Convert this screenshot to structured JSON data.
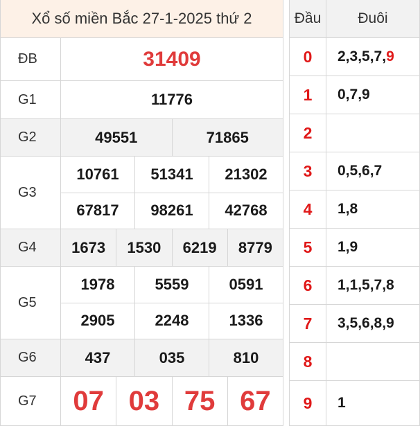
{
  "title": "Xổ số miền Bắc 27-1-2025 thứ 2",
  "prizes": {
    "db": {
      "label": "ĐB",
      "values": [
        "31409"
      ]
    },
    "g1": {
      "label": "G1",
      "values": [
        "11776"
      ]
    },
    "g2": {
      "label": "G2",
      "values": [
        "49551",
        "71865"
      ]
    },
    "g3": {
      "label": "G3",
      "values": [
        "10761",
        "51341",
        "21302",
        "67817",
        "98261",
        "42768"
      ]
    },
    "g4": {
      "label": "G4",
      "values": [
        "1673",
        "1530",
        "6219",
        "8779"
      ]
    },
    "g5": {
      "label": "G5",
      "values": [
        "1978",
        "5559",
        "0591",
        "2905",
        "2248",
        "1336"
      ]
    },
    "g6": {
      "label": "G6",
      "values": [
        "437",
        "035",
        "810"
      ]
    },
    "g7": {
      "label": "G7",
      "values": [
        "07",
        "03",
        "75",
        "67"
      ]
    }
  },
  "loto": {
    "head_label": "Đầu",
    "tail_label": "Đuôi",
    "rows": [
      {
        "head": "0",
        "tails": "2,3,5,7,",
        "tail_highlight": "9"
      },
      {
        "head": "1",
        "tails": "0,7,9",
        "tail_highlight": ""
      },
      {
        "head": "2",
        "tails": "",
        "tail_highlight": ""
      },
      {
        "head": "3",
        "tails": "0,5,6,7",
        "tail_highlight": ""
      },
      {
        "head": "4",
        "tails": "1,8",
        "tail_highlight": ""
      },
      {
        "head": "5",
        "tails": "1,9",
        "tail_highlight": ""
      },
      {
        "head": "6",
        "tails": "1,1,5,7,8",
        "tail_highlight": ""
      },
      {
        "head": "7",
        "tails": "3,5,6,8,9",
        "tail_highlight": ""
      },
      {
        "head": "8",
        "tails": "",
        "tail_highlight": ""
      },
      {
        "head": "9",
        "tails": "1",
        "tail_highlight": ""
      }
    ]
  },
  "colors": {
    "accent_red": "#e03b3b",
    "title_bg": "#fdf1e7",
    "shade_bg": "#f2f2f2"
  }
}
